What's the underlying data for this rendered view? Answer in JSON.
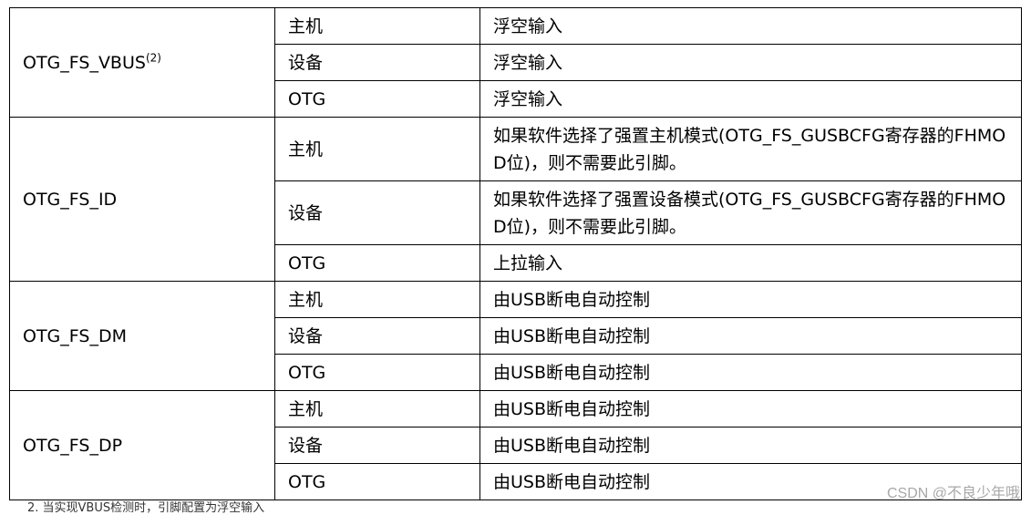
{
  "groups": [
    {
      "pin": "OTG_FS_VBUS",
      "pin_superscript": "(2)",
      "rows": [
        {
          "mode": "主机",
          "description": "浮空输入"
        },
        {
          "mode": "设备",
          "description": "浮空输入"
        },
        {
          "mode": "OTG",
          "description": "浮空输入"
        }
      ]
    },
    {
      "pin": "OTG_FS_ID",
      "rows": [
        {
          "mode": "主机",
          "description": "如果软件选择了强置主机模式(OTG_FS_GUSBCFG寄存器的FHMOD位)，则不需要此引脚。"
        },
        {
          "mode": "设备",
          "description": "如果软件选择了强置设备模式(OTG_FS_GUSBCFG寄存器的FHMOD位)，则不需要此引脚。"
        },
        {
          "mode": "OTG",
          "description": "上拉输入"
        }
      ]
    },
    {
      "pin": "OTG_FS_DM",
      "rows": [
        {
          "mode": "主机",
          "description": "由USB断电自动控制"
        },
        {
          "mode": "设备",
          "description": "由USB断电自动控制"
        },
        {
          "mode": "OTG",
          "description": "由USB断电自动控制"
        }
      ]
    },
    {
      "pin": "OTG_FS_DP",
      "rows": [
        {
          "mode": "主机",
          "description": "由USB断电自动控制"
        },
        {
          "mode": "设备",
          "description": "由USB断电自动控制"
        },
        {
          "mode": "OTG",
          "description": "由USB断电自动控制"
        }
      ]
    }
  ],
  "footnote": "2. 当实现VBUS检测时，引脚配置为浮空输入",
  "watermark": "CSDN @不良少年哦"
}
